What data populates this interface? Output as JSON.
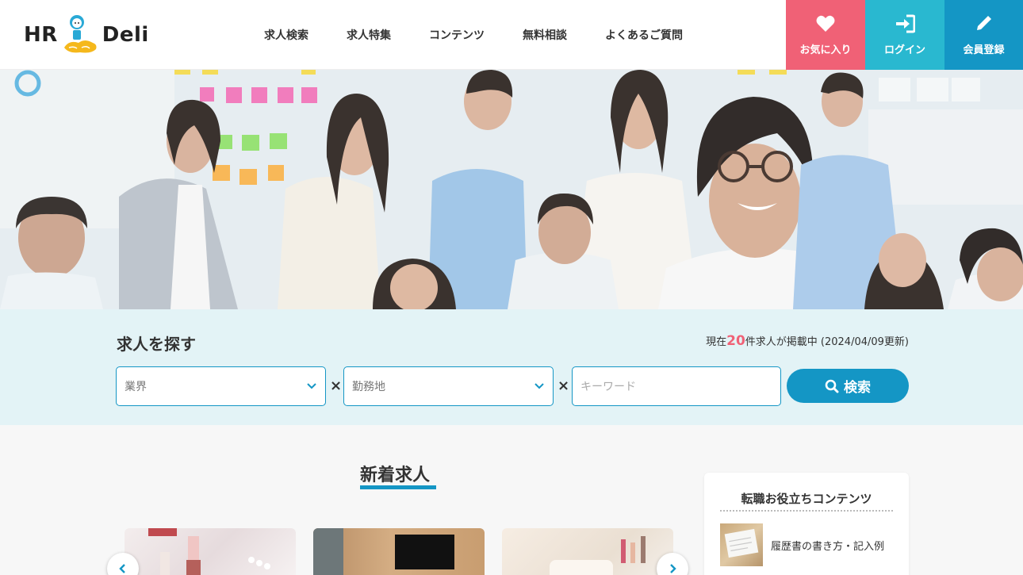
{
  "header": {
    "logo_left": "HR",
    "logo_right": "Deli",
    "nav": [
      "求人検索",
      "求人特集",
      "コンテンツ",
      "無料相談",
      "よくあるご質問"
    ],
    "favorites_label": "お気に入り",
    "login_label": "ログイン",
    "register_label": "会員登録"
  },
  "search": {
    "title": "求人を探す",
    "status_prefix": "現在",
    "count": "20",
    "status_suffix": "件求人が掲載中 (2024/04/09更新)",
    "industry_placeholder": "業界",
    "location_placeholder": "勤務地",
    "keyword_placeholder": "キーワード",
    "separator": "×",
    "button_label": "検索"
  },
  "new_jobs": {
    "title": "新着求人"
  },
  "side": {
    "title": "転職お役立ちコンテンツ",
    "items": [
      "履歴書の書き方・記入例"
    ]
  },
  "colors": {
    "accent": "#1496c5",
    "favorites": "#f06176",
    "login": "#29b8d0",
    "search_bg": "#e3f3f6"
  }
}
